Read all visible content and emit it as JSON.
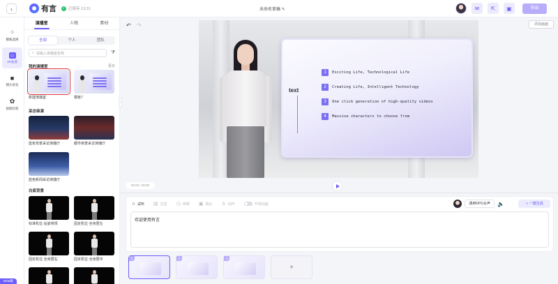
{
  "topbar": {
    "brand": "有言",
    "saved_status": "已保存 13:31",
    "doc_title": "未命名草稿",
    "export_label": "导出"
  },
  "rail": [
    {
      "label": "模板选择",
      "icon": "grid-icon"
    },
    {
      "label": "3D生成",
      "icon": "3d-icon"
    },
    {
      "label": "镜头优化",
      "icon": "camera-icon"
    },
    {
      "label": "视频包装",
      "icon": "package-icon"
    }
  ],
  "version": "Beta版",
  "library": {
    "tabs": [
      "演播室",
      "人物",
      "素材"
    ],
    "subtabs": [
      "全部",
      "个人",
      "团队"
    ],
    "search_placeholder": "请输入演播室名称",
    "sections": {
      "mine": {
        "title": "我的演播室",
        "more": "更多"
      },
      "interview": {
        "title": "采访串演"
      },
      "background": {
        "title": "白底背景"
      }
    },
    "studio_cards": [
      "新建演播室",
      "模板7"
    ],
    "interview_cards": [
      "蓝色背景采访演播厅",
      "都市夜景采访演播厅",
      "蓝色新闻采访演播厅"
    ],
    "background_cards": [
      "标准机位·站姿常规",
      "固定机位·全身居左",
      "固定机位·全身居右",
      "固定机位·全身居中"
    ]
  },
  "canvas": {
    "ppt_button": "添加画面",
    "slide_title": "text",
    "bullets": [
      {
        "num": "1",
        "text": "Exciting Life, Technological Life"
      },
      {
        "num": "2",
        "text": "Creating Life, Intelligent Technology"
      },
      {
        "num": "3",
        "text": "One click generation of high-quality videos"
      },
      {
        "num": "4",
        "text": "Massive characters to choose from"
      }
    ],
    "time": "00:00 / 00:00"
  },
  "editor": {
    "tools": [
      "试听",
      "注音",
      "停顿",
      "镜头",
      "动作",
      "开场动画"
    ],
    "voice_name": "通用RPG女声",
    "generate_label": "一键生成",
    "script_text": "欢迎使用有言"
  },
  "scenes": [
    "1",
    "2",
    "3"
  ]
}
